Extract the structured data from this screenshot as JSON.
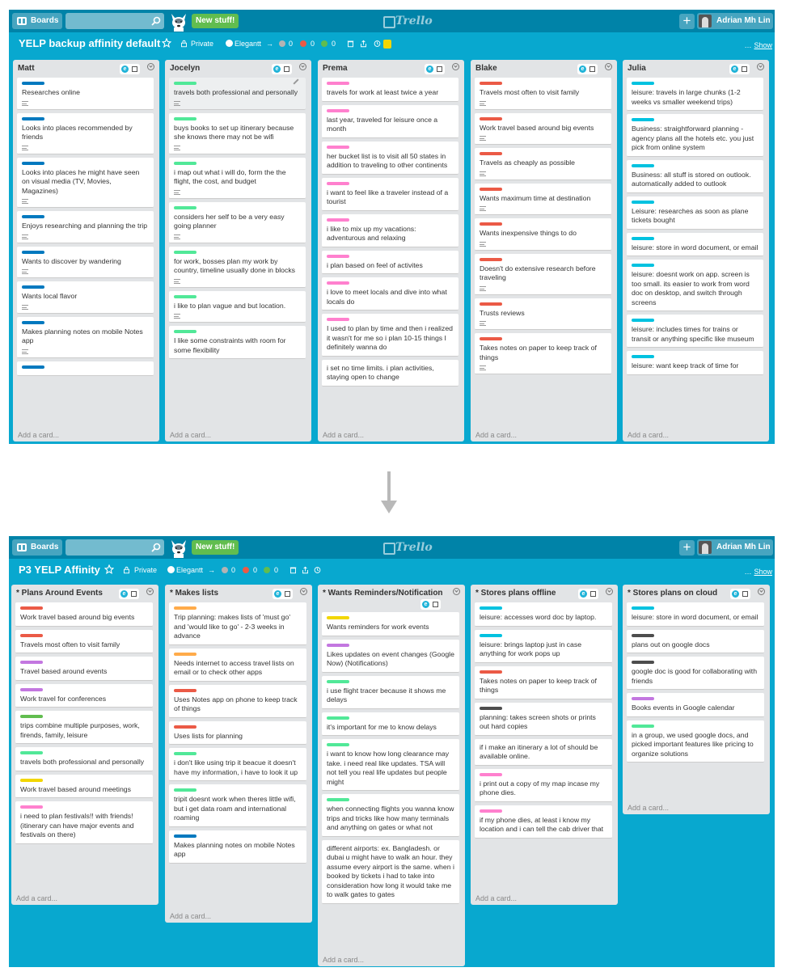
{
  "shots": [
    {
      "topbar": {
        "boards_label": "Boards",
        "new_stuff_label": "New stuff!",
        "logo_label": "Trello",
        "user_name": "Adrian Mh Lin"
      },
      "board": {
        "title": "YELP backup affinity default",
        "visibility_label": "Private",
        "team_label": "Elegantt",
        "counts": [
          "0",
          "0",
          "0"
        ],
        "show_menu_label": "Show",
        "has_notification": true
      },
      "add_card_label": "Add a card...",
      "lists": [
        {
          "title": "Matt",
          "cards": [
            {
              "label": "#0079bf",
              "text": "Researches online",
              "desc": true
            },
            {
              "label": "#0079bf",
              "text": "Looks into places recommended by friends",
              "desc": true
            },
            {
              "label": "#0079bf",
              "text": "Looks into places he might have seen on visual media (TV, Movies, Magazines)",
              "desc": true
            },
            {
              "label": "#0079bf",
              "text": "Enjoys researching and planning the trip",
              "desc": true
            },
            {
              "label": "#0079bf",
              "text": "Wants to discover by wandering",
              "desc": true
            },
            {
              "label": "#0079bf",
              "text": "Wants local flavor",
              "desc": true
            },
            {
              "label": "#0079bf",
              "text": "Makes planning notes on mobile Notes app",
              "desc": true
            },
            {
              "label": "#0079bf",
              "text": "",
              "desc": false
            }
          ]
        },
        {
          "title": "Jocelyn",
          "cards": [
            {
              "label": "#51e898",
              "text": "travels both professional and personally",
              "desc": true,
              "shaded": true
            },
            {
              "label": "#51e898",
              "text": "buys books to set up itinerary because she knows there may not be wifi",
              "desc": true
            },
            {
              "label": "#51e898",
              "text": "i map out what i will do, form the the flight, the cost, and budget",
              "desc": true
            },
            {
              "label": "#51e898",
              "text": "considers her self to be a very easy going planner",
              "desc": true
            },
            {
              "label": "#51e898",
              "text": "for work, bosses plan my work by country, timeline usually done in blocks",
              "desc": true
            },
            {
              "label": "#51e898",
              "text": "i like to plan vague and but location.",
              "desc": true
            },
            {
              "label": "#51e898",
              "text": "I like some constraints with room for some flexibility",
              "desc": false
            }
          ]
        },
        {
          "title": "Prema",
          "cards": [
            {
              "label": "#ff80ce",
              "text": "travels for work at least twice a year",
              "desc": false
            },
            {
              "label": "#ff80ce",
              "text": "last year, traveled for leisure once a month",
              "desc": false
            },
            {
              "label": "#ff80ce",
              "text": "her bucket list is to visit all 50 states in addition to traveling to other continents",
              "desc": false
            },
            {
              "label": "#ff80ce",
              "text": "i want to feel like a traveler instead of a tourist",
              "desc": false
            },
            {
              "label": "#ff80ce",
              "text": "i like to mix up my vacations: adventurous and relaxing",
              "desc": false
            },
            {
              "label": "#ff80ce",
              "text": "i plan based on feel of activites",
              "desc": false
            },
            {
              "label": "#ff80ce",
              "text": "i love to meet locals and dive into what locals do",
              "desc": false
            },
            {
              "label": "#ff80ce",
              "text": "I used to plan by time and then i realized it wasn't for me so i plan 10-15 things I definitely wanna do",
              "desc": false
            },
            {
              "label": "",
              "text": "i set no time limits. i plan activities, staying open to change",
              "desc": false
            }
          ]
        },
        {
          "title": "Blake",
          "cards": [
            {
              "label": "#eb5a46",
              "text": "Travels most often to visit family",
              "desc": true
            },
            {
              "label": "#eb5a46",
              "text": "Work travel based around big events",
              "desc": true
            },
            {
              "label": "#eb5a46",
              "text": "Travels as cheaply as possible",
              "desc": true
            },
            {
              "label": "#eb5a46",
              "text": "Wants maximum time at destination",
              "desc": true
            },
            {
              "label": "#eb5a46",
              "text": "Wants inexpensive things to do",
              "desc": true
            },
            {
              "label": "#eb5a46",
              "text": "Doesn't do extensive research before traveling",
              "desc": true
            },
            {
              "label": "#eb5a46",
              "text": "Trusts reviews",
              "desc": true
            },
            {
              "label": "#eb5a46",
              "text": "Takes notes on paper to keep track of things",
              "desc": true
            }
          ]
        },
        {
          "title": "Julia",
          "cards": [
            {
              "label": "#00c2e0",
              "text": "leisure: travels in large chunks (1-2 weeks vs smaller weekend trips)",
              "desc": false
            },
            {
              "label": "#00c2e0",
              "text": "Business: straightforward planning - agency plans all the hotels etc. you just pick from online system",
              "desc": false
            },
            {
              "label": "#00c2e0",
              "text": "Business: all stuff is stored on outlook. automatically added to outlook",
              "desc": false
            },
            {
              "label": "#00c2e0",
              "text": "Leisure: researches as soon as plane tickets bought",
              "desc": false
            },
            {
              "label": "#00c2e0",
              "text": "leisure: store in word document, or email",
              "desc": false
            },
            {
              "label": "#00c2e0",
              "text": "leisure: doesnt work on app. screen is too small. its easier to work from word doc on desktop, and switch through screens",
              "desc": false
            },
            {
              "label": "#00c2e0",
              "text": "leisure: includes times for trains or transit or anything specific like museum",
              "desc": false
            },
            {
              "label": "#00c2e0",
              "text": "leisure: want keep track of time for",
              "desc": false
            }
          ]
        }
      ]
    },
    {
      "topbar": {
        "boards_label": "Boards",
        "new_stuff_label": "New stuff!",
        "logo_label": "Trello",
        "user_name": "Adrian Mh Lin"
      },
      "board": {
        "title": "P3 YELP Affinity",
        "visibility_label": "Private",
        "team_label": "Elegantt",
        "counts": [
          "0",
          "0",
          "0"
        ],
        "show_menu_label": "Show",
        "has_notification": false
      },
      "add_card_label": "Add a card...",
      "lists": [
        {
          "title": "* Plans Around Events",
          "cards": [
            {
              "label": "#eb5a46",
              "text": "Work travel based around big events"
            },
            {
              "label": "#eb5a46",
              "text": "Travels most often to visit family"
            },
            {
              "label": "#c377e0",
              "text": "Travel based around events"
            },
            {
              "label": "#c377e0",
              "text": "Work travel for conferences"
            },
            {
              "label": "#61bd4f",
              "text": "trips combine multiple purposes, work, firends, family, leisure"
            },
            {
              "label": "#51e898",
              "text": "travels both professional and personally"
            },
            {
              "label": "#f2d600",
              "text": "Work travel based around meetings"
            },
            {
              "label": "#ff80ce",
              "text": "i need to plan festivals!! with friends! (itinerary can have major events and festivals on there)"
            }
          ]
        },
        {
          "title": "* Makes lists",
          "cards": [
            {
              "label": "#ffab4a",
              "text": "Trip planning: makes lists of 'must go' and 'would like to go' - 2-3 weeks in advance"
            },
            {
              "label": "#ffab4a",
              "text": "Needs internet to access travel lists on email or to check other apps"
            },
            {
              "label": "#eb5a46",
              "text": "Uses Notes app on phone to keep track of things"
            },
            {
              "label": "#eb5a46",
              "text": "Uses lists for planning"
            },
            {
              "label": "#51e898",
              "text": "i don't like using trip it beacue it doesn't have my information, i have to look it up"
            },
            {
              "label": "#51e898",
              "text": "tripit doesnt work when theres little wifi, but i get data roam and international roaming"
            },
            {
              "label": "#0079bf",
              "text": "Makes planning notes on mobile Notes app"
            }
          ]
        },
        {
          "title": "* Wants Reminders/Notification",
          "cards": [
            {
              "label": "#f2d600",
              "text": "Wants reminders for work events"
            },
            {
              "label": "#c377e0",
              "text": "Likes updates on event changes (Google Now) (Notifications)"
            },
            {
              "label": "#51e898",
              "text": "i use flight tracer because it shows me delays"
            },
            {
              "label": "#51e898",
              "text": "it's important for me to know delays"
            },
            {
              "label": "#51e898",
              "text": "i want to know how long clearance may take. i need real like updates. TSA will not tell you real life updates but people might"
            },
            {
              "label": "#51e898",
              "text": "when connecting flights you wanna know trips and tricks like how many terminals and anything on gates or what not"
            },
            {
              "label": "",
              "text": "different airports: ex. Bangladesh. or dubai u might have to walk an hour. they assume every airport is the same. when i booked by tickets i had to take into consideration how long it would take me to walk gates to gates"
            }
          ]
        },
        {
          "title": "* Stores plans offline",
          "cards": [
            {
              "label": "#00c2e0",
              "text": "leisure: accesses word doc by laptop."
            },
            {
              "label": "#00c2e0",
              "text": "leisure: brings laptop just in case anything for work pops up"
            },
            {
              "label": "#eb5a46",
              "text": "Takes notes on paper to keep track of things"
            },
            {
              "label": "#4d4d4d",
              "text": "planning: takes screen shots or prints out hard copies"
            },
            {
              "label": "",
              "text": "if i make an itinerary a lot of should be available online."
            },
            {
              "label": "#ff80ce",
              "text": "i print out a copy of my map incase my phone dies."
            },
            {
              "label": "#ff80ce",
              "text": "if my phone dies, at least i know my location and i can tell the cab driver that"
            }
          ]
        },
        {
          "title": "* Stores plans on cloud",
          "cards": [
            {
              "label": "#00c2e0",
              "text": "leisure: store in word document, or email"
            },
            {
              "label": "#4d4d4d",
              "text": "plans out on google docs"
            },
            {
              "label": "#4d4d4d",
              "text": "google doc is good for collaborating with friends"
            },
            {
              "label": "#c377e0",
              "text": "Books events in Google calendar"
            },
            {
              "label": "#51e898",
              "text": "in a group, we used google docs, and picked important features like pricing to organize solutions"
            }
          ]
        }
      ]
    }
  ]
}
